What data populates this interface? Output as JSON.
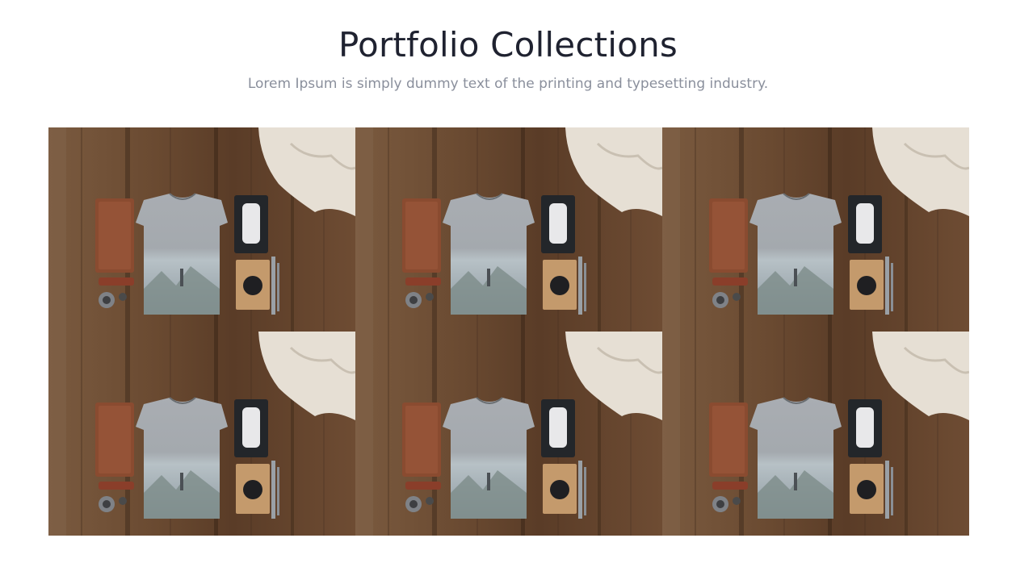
{
  "header": {
    "title": "Portfolio Collections",
    "subtitle": "Lorem Ipsum is simply dummy text of the printing and typesetting industry."
  },
  "portfolio": {
    "items": [
      {
        "image": "flatlay-tshirt-photo"
      },
      {
        "image": "flatlay-tshirt-photo"
      },
      {
        "image": "flatlay-tshirt-photo"
      },
      {
        "image": "flatlay-tshirt-photo"
      },
      {
        "image": "flatlay-tshirt-photo"
      },
      {
        "image": "flatlay-tshirt-photo"
      }
    ]
  },
  "colors": {
    "title": "#1f2230",
    "subtitle": "#8a8f9c",
    "wood": "#6b4a32",
    "shirt": "#a7abb0"
  }
}
